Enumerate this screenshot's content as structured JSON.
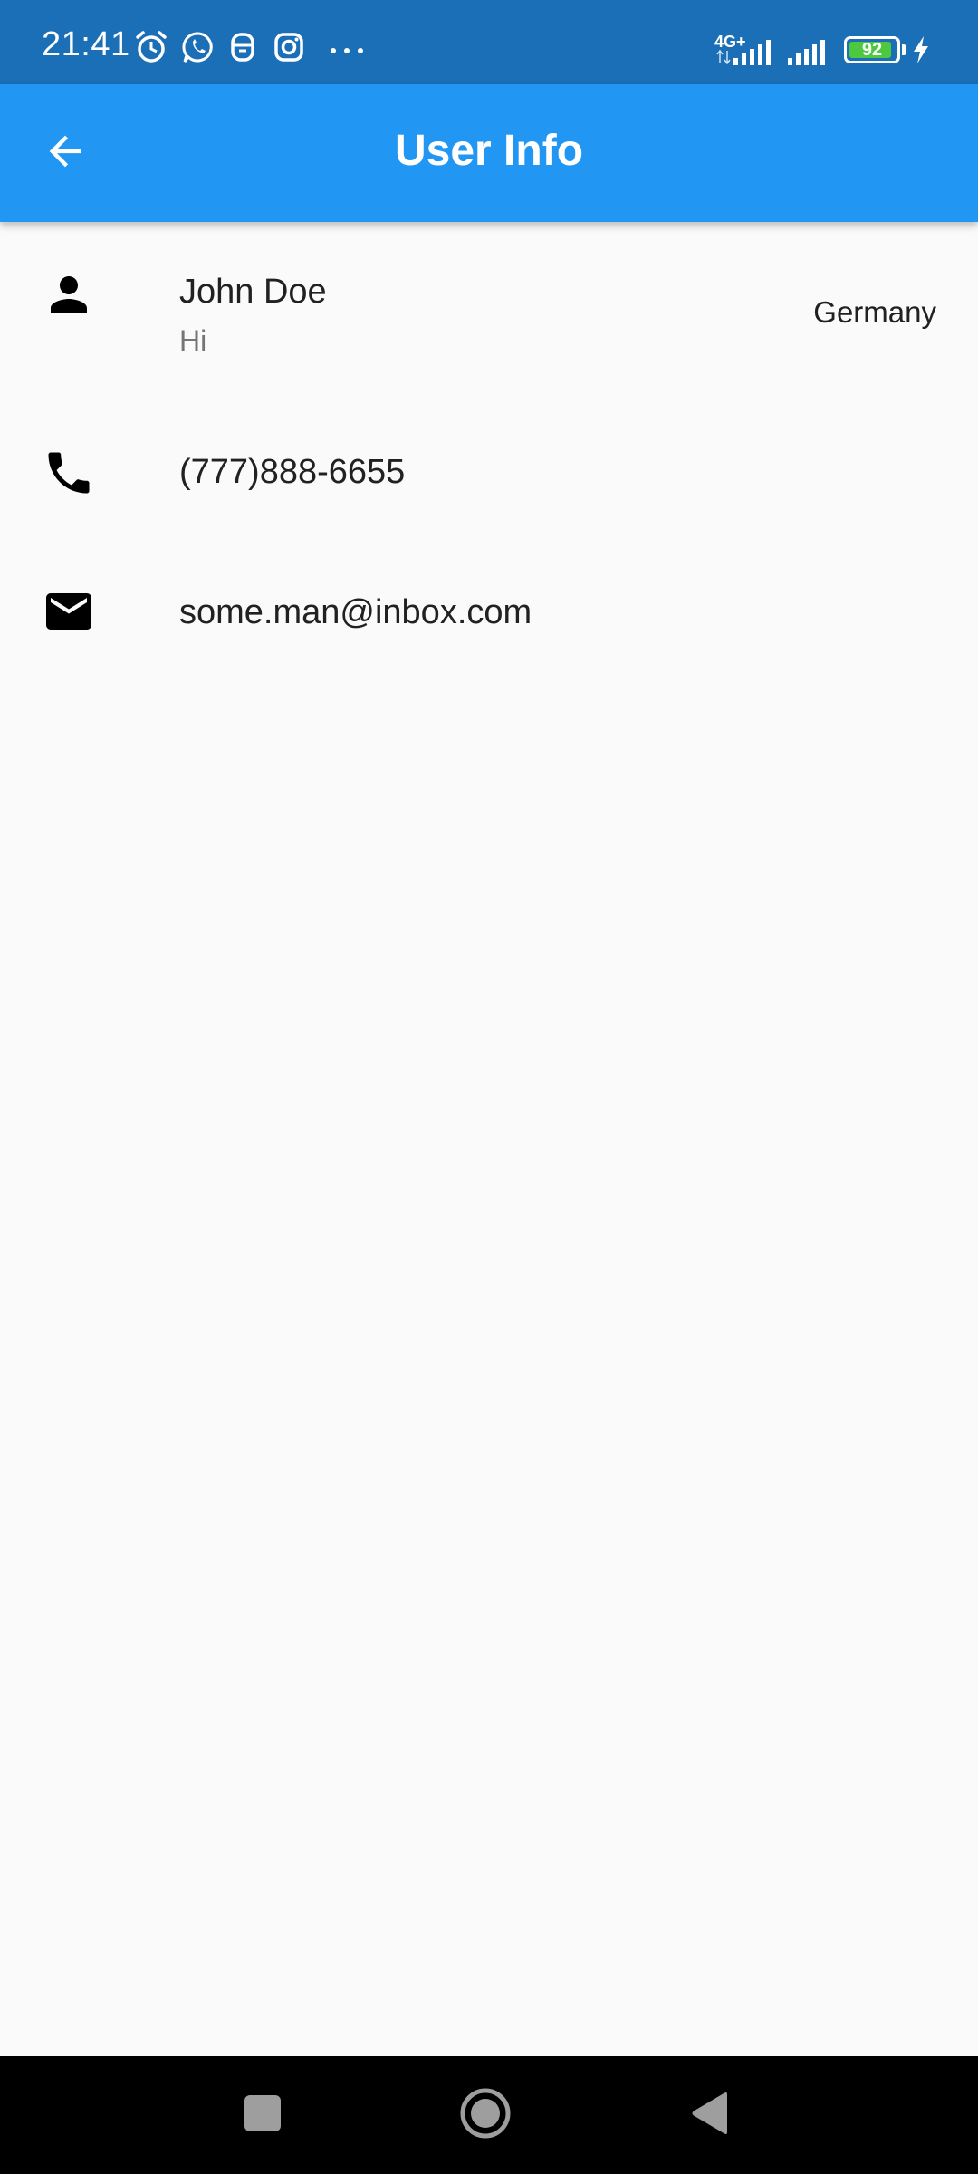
{
  "status_bar": {
    "time": "21:41",
    "network_label": "4G+",
    "battery_level": "92",
    "battery_fraction": 0.92,
    "background_color": "#1b6fb6",
    "notification_icons": [
      "alarm-icon",
      "whatsapp-icon",
      "app-notification-icon",
      "instagram-icon",
      "more-dots-icon"
    ],
    "system_icons": [
      "signal-4g-icon",
      "signal-icon",
      "battery-icon",
      "charging-icon"
    ]
  },
  "app_bar": {
    "title": "User Info",
    "back_icon": "arrow-back-icon",
    "background_color": "#2196f3"
  },
  "user": {
    "name": "John Doe",
    "status": "Hi",
    "country": "Germany",
    "phone": "(777)888-6655",
    "email": "some.man@inbox.com"
  },
  "icons": {
    "person": "person-icon",
    "phone": "phone-icon",
    "email": "email-icon"
  },
  "nav_bar": {
    "buttons": [
      "recents-button",
      "home-button",
      "back-button"
    ]
  }
}
